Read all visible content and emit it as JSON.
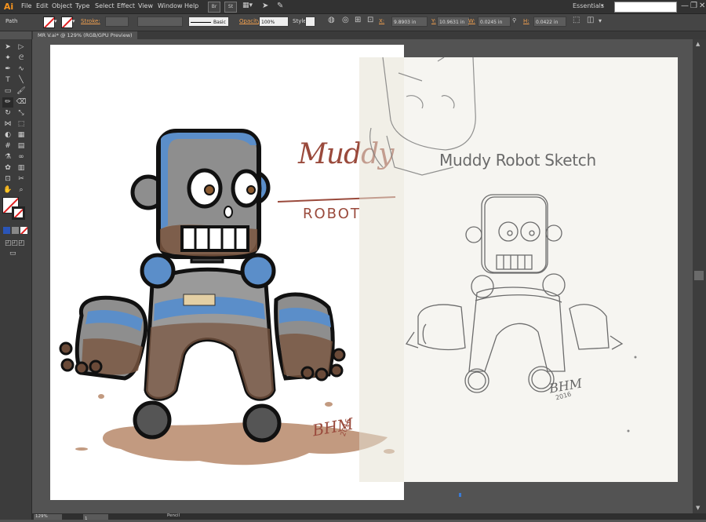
{
  "app": {
    "logo": "Ai"
  },
  "menu": [
    "File",
    "Edit",
    "Object",
    "Type",
    "Select",
    "Effect",
    "View",
    "Window",
    "Help"
  ],
  "app_buttons": [
    "Br",
    "St"
  ],
  "workspace": "Essentials",
  "window_controls": {
    "minimize": "—",
    "restore": "❐",
    "close": "✕"
  },
  "control_bar": {
    "selection": "Path",
    "stroke_label": "Stroke:",
    "brush": "Basic",
    "opacity_label": "Opacity:",
    "opacity": "100%",
    "style_label": "Style:",
    "x_label": "X:",
    "x": "9.8903 in",
    "y_label": "Y:",
    "y": "10.9631 in",
    "w_label": "W:",
    "w": "0.0245 in",
    "h_label": "H:",
    "h": "0.0422 in"
  },
  "document_tab": "MR V.ai* @ 129% (RGB/GPU Preview)",
  "artwork": {
    "title_word1": "Muddy",
    "title_word2": "ROBOT",
    "signature": "BHM",
    "signature_year": "2016"
  },
  "sketch": {
    "title": "Muddy Robot Sketch",
    "signature": "BHM",
    "signature_year": "2016"
  },
  "status": {
    "zoom": "129%",
    "page": "1",
    "tool": "Pencil"
  },
  "colors": {
    "robot_blue": "#5b8ec9",
    "robot_gray": "#8e8e8e",
    "mud": "#7a5640",
    "puddle": "#c29a80",
    "title_red": "#9a4a3c"
  }
}
